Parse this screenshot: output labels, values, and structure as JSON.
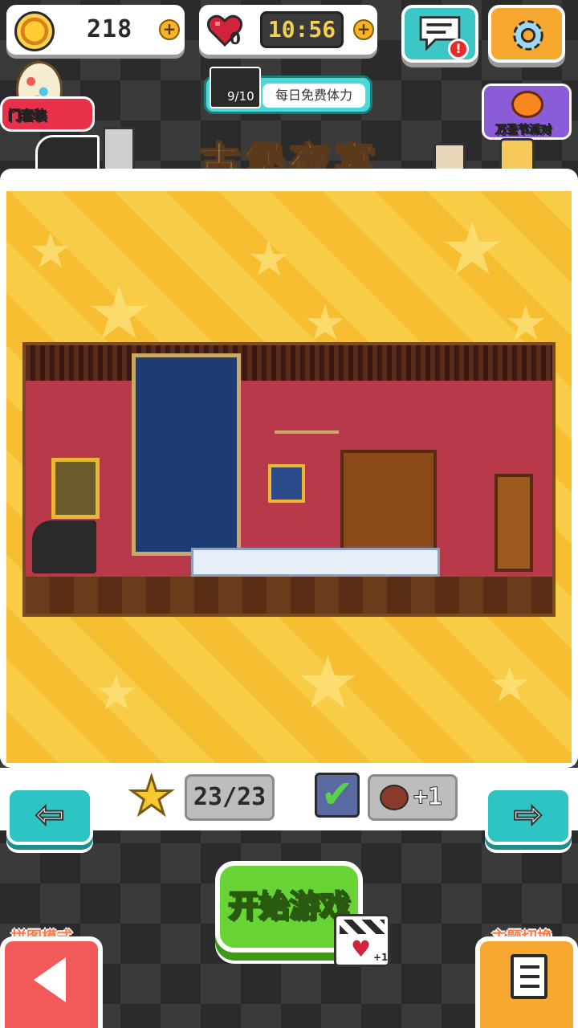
{
  "top_bar": {
    "coins": "218",
    "lives": "0",
    "timer": "10:56",
    "plus_symbol": "+"
  },
  "banners": {
    "outfit_tag": "门套装",
    "daily_stamina_count": "9/10",
    "daily_stamina_label": "每日免费体力",
    "halloween_tag": "万圣节派对"
  },
  "level": {
    "title": "古堡夜宴",
    "stars": "23/23",
    "reward": "+1"
  },
  "actions": {
    "start_label": "开始游戏",
    "ad_reward": "+1",
    "puzzle_mode_label": "拼图模式",
    "theme_switch_label": "主题切换"
  },
  "colors": {
    "accent_yellow": "#f6be30",
    "teal": "#2ec4c4",
    "green": "#67d334",
    "coral": "#f25a5a",
    "orange": "#f7a830"
  }
}
